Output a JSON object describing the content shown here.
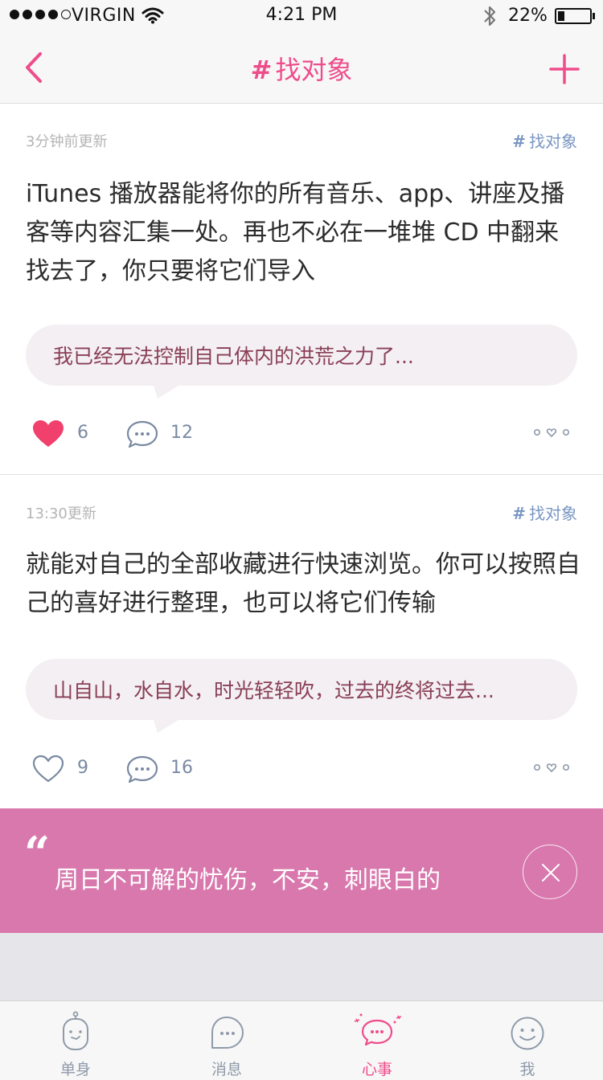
{
  "status_bar": {
    "carrier": "VIRGIN",
    "time": "4:21 PM",
    "battery": "22%",
    "battery_level": 0.22,
    "signal_bars_filled": 4,
    "signal_bars_total": 5
  },
  "nav": {
    "hash": "#",
    "title": "找对象",
    "back_icon": "chevron-left-icon",
    "add_icon": "plus-icon"
  },
  "posts": [
    {
      "time": "3分钟前更新",
      "tag_hash": "#",
      "tag": "找对象",
      "body": "iTunes 播放器能将你的所有音乐、app、讲座及播客等内容汇集一处。再也不必在一堆堆 CD 中翻来找去了，你只要将它们导入",
      "reply": "我已经无法控制自己体内的洪荒之力了...",
      "liked": true,
      "likes": "6",
      "comments": "12"
    },
    {
      "time": "13:30更新",
      "tag_hash": "#",
      "tag": "找对象",
      "body": "就能对自己的全部收藏进行快速浏览。你可以按照自己的喜好进行整理，也可以将它们传输",
      "reply": "山自山，水自水，时光轻轻吹，过去的终将过去...",
      "liked": false,
      "likes": "9",
      "comments": "16"
    }
  ],
  "banner": {
    "quote_mark": "“",
    "text": "周日不可解的忧伤，不安，刺眼白的"
  },
  "tabs": [
    {
      "label": "单身",
      "icon": "single-icon",
      "active": false
    },
    {
      "label": "消息",
      "icon": "message-icon",
      "active": false
    },
    {
      "label": "心事",
      "icon": "heart-bubble-icon",
      "active": true
    },
    {
      "label": "我",
      "icon": "smile-icon",
      "active": false
    }
  ],
  "colors": {
    "accent": "#ee4d8b",
    "tag_blue": "#7a96c2",
    "banner": "#d878ad",
    "reply_text": "#8a3f56",
    "tab_inactive": "#8f9aaa"
  }
}
